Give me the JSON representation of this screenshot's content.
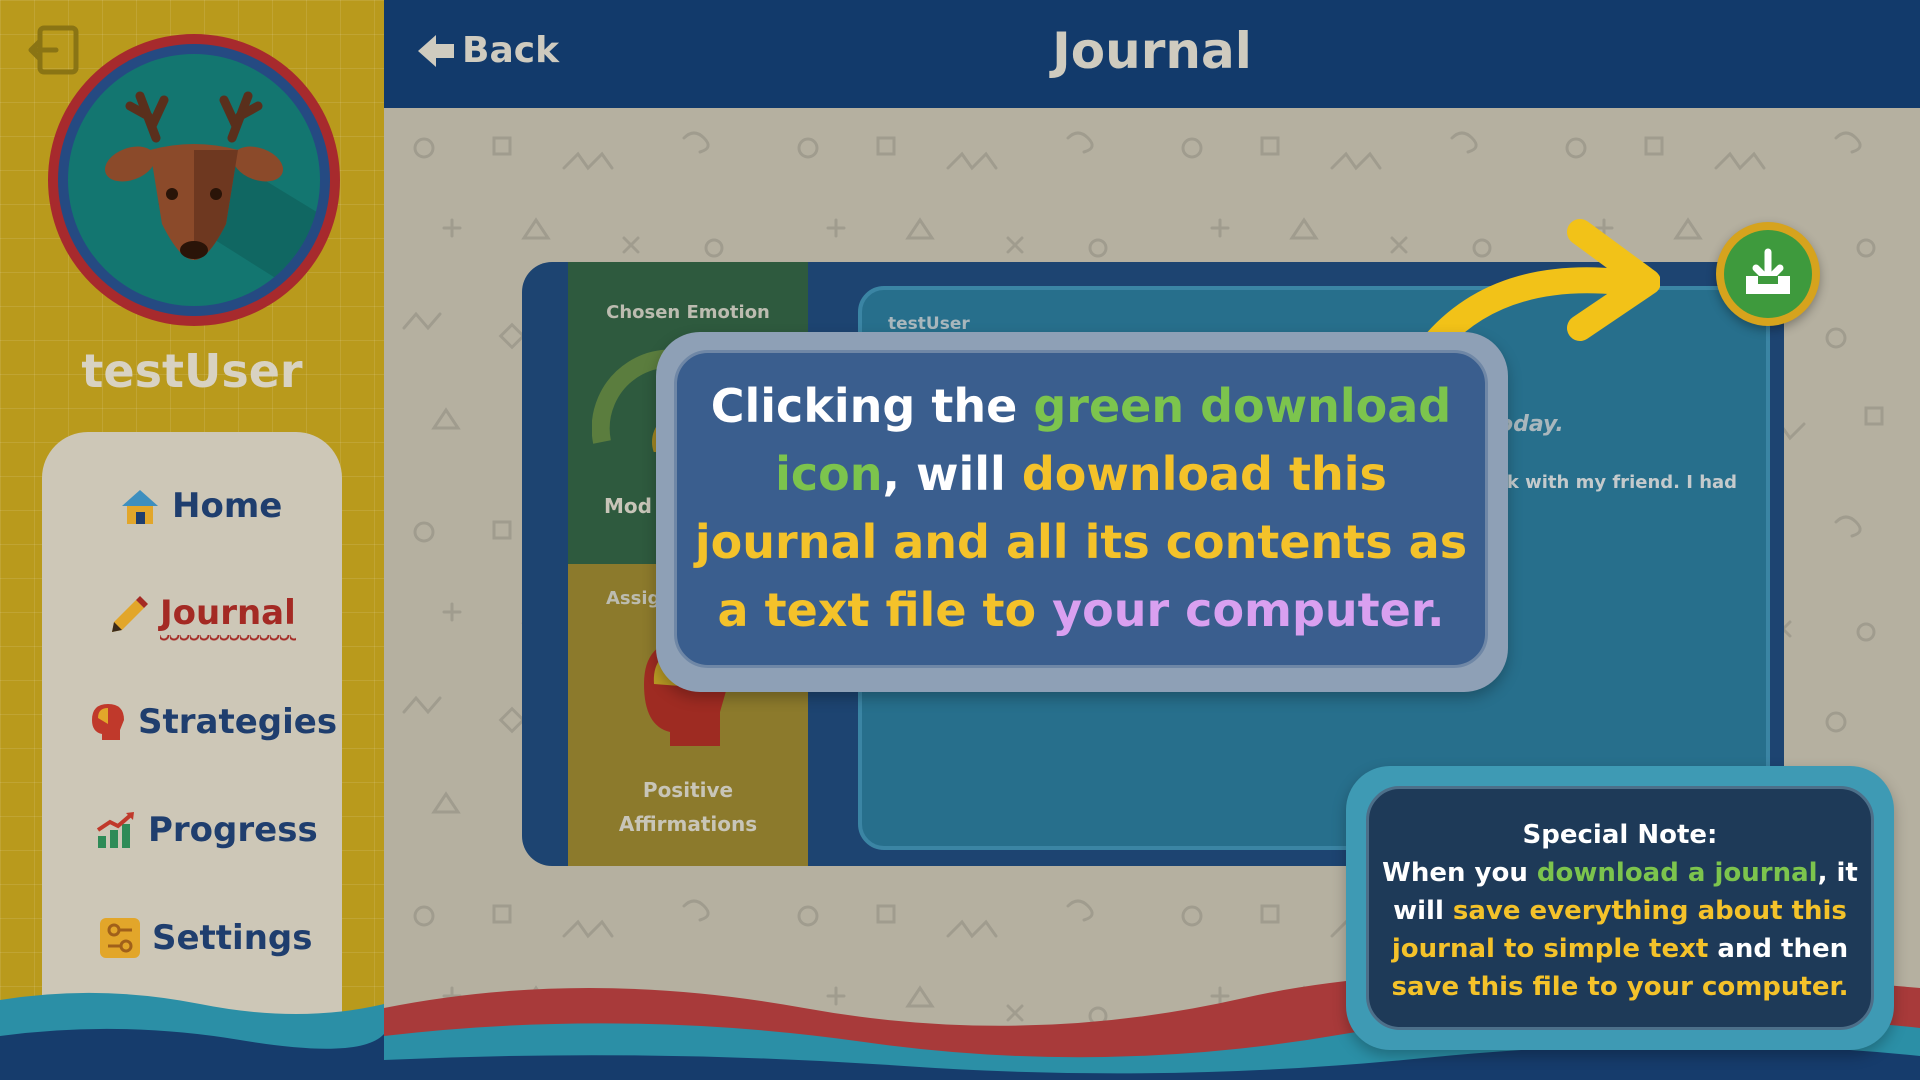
{
  "colors": {
    "accent_green": "#7cc44d",
    "accent_yellow": "#f4c22a",
    "accent_purple": "#d9a0f0",
    "header_bg": "#123a6b",
    "sidebar_bg": "#b99a1c"
  },
  "sidebar": {
    "username": "testUser",
    "avatar_icon": "deer-icon",
    "nav": [
      {
        "label": "Home",
        "icon": "home-icon"
      },
      {
        "label": "Journal",
        "icon": "pencil-icon",
        "active": true
      },
      {
        "label": "Strategies",
        "icon": "head-icon"
      },
      {
        "label": "Progress",
        "icon": "chart-icon"
      },
      {
        "label": "Settings",
        "icon": "sliders-icon"
      }
    ]
  },
  "header": {
    "back_label": "Back",
    "title": "Journal"
  },
  "journal": {
    "chosen_emotion_label": "Chosen Emotion",
    "mood_label": "Mod",
    "assign_label": "Assig",
    "affirm_line1": "Positive",
    "affirm_line2": "Affirmations",
    "entry_user": "testUser",
    "entry_heading": "oday.",
    "entry_text": "rk with my friend. I had"
  },
  "tooltip": {
    "p1": "Clicking the ",
    "p2": "green download icon",
    "p3": ", will ",
    "p4": "download this journal and all its contents as a text file to ",
    "p5": "your computer."
  },
  "note": {
    "title": "Special Note:",
    "p1": "When you ",
    "p2": "download a journal",
    "p3": ", it will ",
    "p4": "save everything about this journal to simple text",
    "p5": " and then ",
    "p6": "save this file to your computer."
  }
}
